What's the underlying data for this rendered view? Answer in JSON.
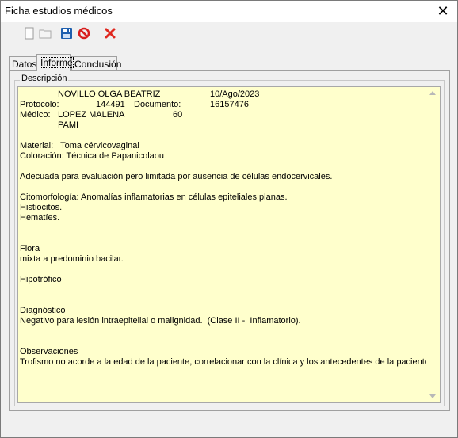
{
  "window": {
    "title": "Ficha estudios médicos",
    "close_glyph": "✕"
  },
  "toolbar": {
    "icons": [
      "new-document-icon",
      "open-folder-icon",
      "save-icon",
      "cancel-icon",
      "delete-icon"
    ]
  },
  "tabs": [
    {
      "label": "Datos"
    },
    {
      "label": "Informe"
    },
    {
      "label": "Conclusión"
    }
  ],
  "active_tab": "Informe",
  "group_label": "Descripción",
  "report": {
    "patient_name": "NOVILLO OLGA BEATRIZ",
    "date": "10/Ago/2023",
    "protocolo_label": "Protocolo:",
    "protocolo_value": "144491",
    "documento_label": "Documento:",
    "documento_value": "16157476",
    "medico_label": "Médico:",
    "medico_value": "LOPEZ MALENA",
    "medico_code": "60",
    "cobertura": "PAMI",
    "material_line": "Material:   Toma cérvicovaginal",
    "coloracion_line": "Coloración: Técnica de Papanicolaou",
    "adecuada": "Adecuada para evaluación pero limitada por ausencia de células endocervicales.",
    "citomorfologia": "Citomorfología: Anomalías inflamatorias en células epiteliales planas.",
    "histiocitos": "Histiocitos.",
    "hematies": "Hematíes.",
    "flora_title": "Flora",
    "flora_text": "mixta a predominio bacilar.",
    "hipotrofico": "Hipotrófico",
    "diagnostico_title": "Diagnóstico",
    "diagnostico_text": "Negativo para lesión intraepitelial o malignidad.  (Clase II -  Inflamatorio).",
    "observaciones_title": "Observaciones",
    "observaciones_text": "Trofismo no acorde a la edad de la paciente, correlacionar con la clínica y los antecedentes de la paciente"
  },
  "colors": {
    "memo_background": "#ffffcc",
    "save_icon": "#1e5fae",
    "cancel_icon": "#d81f1f",
    "delete_icon": "#e0281f"
  }
}
